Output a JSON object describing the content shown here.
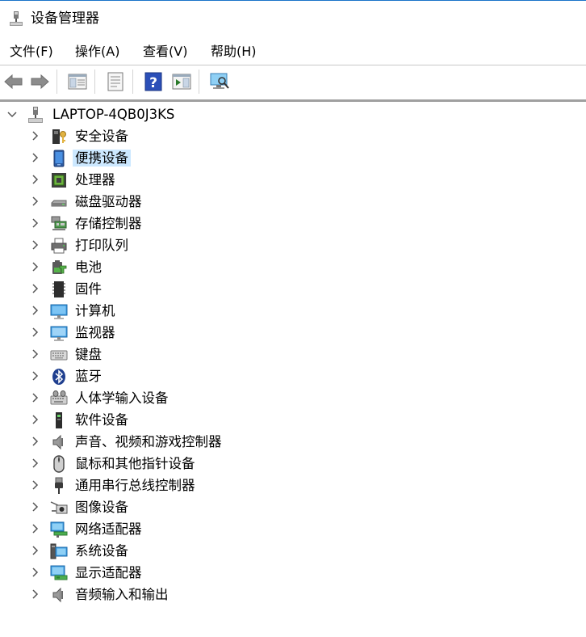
{
  "window": {
    "title": "设备管理器"
  },
  "menubar": {
    "items": [
      "文件(F)",
      "操作(A)",
      "查看(V)",
      "帮助(H)"
    ]
  },
  "toolbar": {
    "buttons": [
      "back-arrow-icon",
      "forward-arrow-icon",
      "show-hide-tree-icon",
      "properties-icon",
      "help-icon",
      "action-pane-icon",
      "scan-hardware-icon"
    ]
  },
  "tree": {
    "root": "LAPTOP-4QB0J3KS",
    "items": [
      {
        "label": "安全设备",
        "icon": "security-key-icon"
      },
      {
        "label": "便携设备",
        "icon": "portable-device-icon",
        "selected": true
      },
      {
        "label": "处理器",
        "icon": "processor-icon"
      },
      {
        "label": "磁盘驱动器",
        "icon": "disk-drive-icon"
      },
      {
        "label": "存储控制器",
        "icon": "storage-controller-icon"
      },
      {
        "label": "打印队列",
        "icon": "printer-icon"
      },
      {
        "label": "电池",
        "icon": "battery-icon"
      },
      {
        "label": "固件",
        "icon": "firmware-icon"
      },
      {
        "label": "计算机",
        "icon": "computer-icon"
      },
      {
        "label": "监视器",
        "icon": "monitor-icon"
      },
      {
        "label": "键盘",
        "icon": "keyboard-icon"
      },
      {
        "label": "蓝牙",
        "icon": "bluetooth-icon"
      },
      {
        "label": "人体学输入设备",
        "icon": "hid-icon"
      },
      {
        "label": "软件设备",
        "icon": "software-device-icon"
      },
      {
        "label": "声音、视频和游戏控制器",
        "icon": "speaker-icon"
      },
      {
        "label": "鼠标和其他指针设备",
        "icon": "mouse-icon"
      },
      {
        "label": "通用串行总线控制器",
        "icon": "usb-icon"
      },
      {
        "label": "图像设备",
        "icon": "camera-icon"
      },
      {
        "label": "网络适配器",
        "icon": "network-adapter-icon"
      },
      {
        "label": "系统设备",
        "icon": "system-device-icon"
      },
      {
        "label": "显示适配器",
        "icon": "display-adapter-icon"
      },
      {
        "label": "音频输入和输出",
        "icon": "audio-io-icon"
      }
    ]
  }
}
